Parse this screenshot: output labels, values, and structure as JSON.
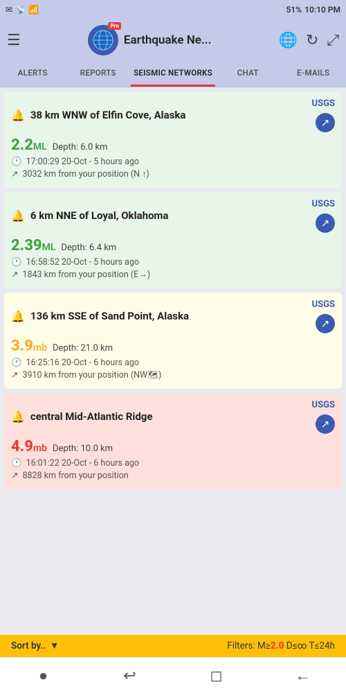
{
  "statusBar": {
    "left": [
      "✉",
      "☰",
      "📶"
    ],
    "battery": "51%",
    "time": "10:10 PM",
    "signalIcon": "📶"
  },
  "header": {
    "menuLabel": "☰",
    "title": "Earthquake Ne...",
    "proBadge": "Pro",
    "globeIcon": "🌐",
    "refreshIcon": "↻",
    "expandIcon": "⤢"
  },
  "tabs": [
    {
      "id": "alerts",
      "label": "ALERTS"
    },
    {
      "id": "reports",
      "label": "REPORTS"
    },
    {
      "id": "seismic",
      "label": "SEISMIC NETWORKS",
      "active": true
    },
    {
      "id": "chat",
      "label": "CHAT"
    },
    {
      "id": "emails",
      "label": "E-MAILS"
    }
  ],
  "earthquakes": [
    {
      "id": "eq1",
      "icon": "🔔",
      "title": "38 km WNW of Elfin Cove, Alaska",
      "source": "USGS",
      "magnitude": "2.2",
      "magUnit": "ML",
      "magColor": "green",
      "depth": "Depth: 6.0 km",
      "time": "17:00:29 20-Oct - 5 hours ago",
      "distance": "3032 km from your position (N ↑)",
      "cardColor": "green"
    },
    {
      "id": "eq2",
      "icon": "🔔",
      "title": "6 km NNE of Loyal, Oklahoma",
      "source": "USGS",
      "magnitude": "2.39",
      "magUnit": "ML",
      "magColor": "green",
      "depth": "Depth: 6.4 km",
      "time": "16:58:52 20-Oct - 5 hours ago",
      "distance": "1843 km from your position (E→)",
      "cardColor": "green"
    },
    {
      "id": "eq3",
      "icon": "🔔",
      "title": "136 km SSE of Sand Point, Alaska",
      "source": "USGS",
      "magnitude": "3.9",
      "magUnit": "mb",
      "magColor": "yellow",
      "depth": "Depth: 21.0 km",
      "time": "16:25:16 20-Oct - 6 hours ago",
      "distance": "3910 km from your position (NW🗺)",
      "cardColor": "yellow"
    },
    {
      "id": "eq4",
      "icon": "🔔",
      "title": "central Mid-Atlantic Ridge",
      "source": "USGS",
      "magnitude": "4.9",
      "magUnit": "mb",
      "magColor": "red",
      "depth": "Depth: 10.0 km",
      "time": "16:01:22 20-Oct - 6 hours ago",
      "distance": "8828 km from your position",
      "cardColor": "red"
    }
  ],
  "bottomBar": {
    "sortLabel": "Sort by..",
    "filterText": "Filters: M≥",
    "filterMag": "2.0",
    "filterRest": " D≤∞ T≤24h"
  },
  "navBar": {
    "dot": "●",
    "reply": "↩",
    "square": "◻",
    "back": "←"
  }
}
